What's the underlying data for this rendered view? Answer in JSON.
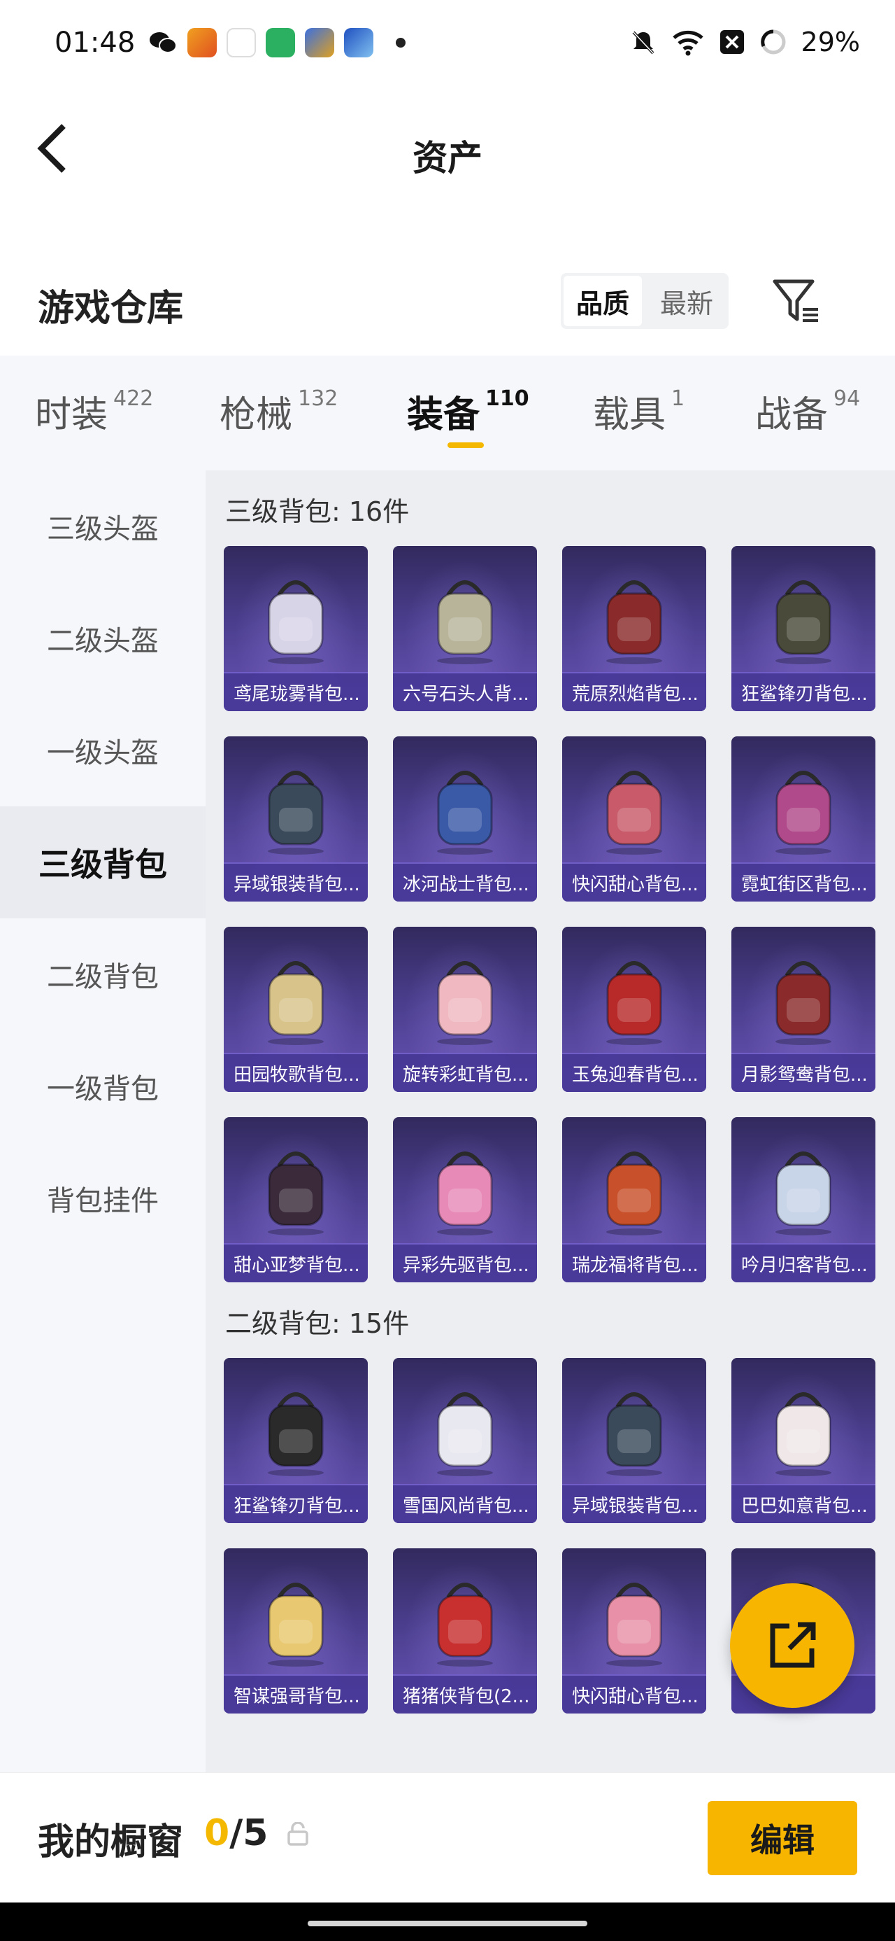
{
  "status_bar": {
    "time": "01:48",
    "battery": "29%"
  },
  "header": {
    "title": "资产"
  },
  "warehouse": {
    "title": "游戏仓库",
    "sort_options": [
      "品质",
      "最新"
    ],
    "active_sort": "品质"
  },
  "tabs": [
    {
      "label": "时装",
      "count": "422"
    },
    {
      "label": "枪械",
      "count": "132"
    },
    {
      "label": "装备",
      "count": "110"
    },
    {
      "label": "载具",
      "count": "1"
    },
    {
      "label": "战备",
      "count": "94"
    }
  ],
  "active_tab": "装备",
  "sidebar": {
    "items": [
      "三级头盔",
      "二级头盔",
      "一级头盔",
      "三级背包",
      "二级背包",
      "一级背包",
      "背包挂件"
    ],
    "active": "三级背包"
  },
  "sections": [
    {
      "title": "三级背包: 16件",
      "items": [
        {
          "name": "鸢尾珑雾背包...",
          "color": "#d8d4e8"
        },
        {
          "name": "六号石头人背...",
          "color": "#b8b49a"
        },
        {
          "name": "荒原烈焰背包...",
          "color": "#8a2a2a"
        },
        {
          "name": "狂鲨锋刃背包...",
          "color": "#4a4a3a"
        },
        {
          "name": "异域银装背包...",
          "color": "#3a4a5a"
        },
        {
          "name": "冰河战士背包...",
          "color": "#3a5aa8"
        },
        {
          "name": "快闪甜心背包...",
          "color": "#c85a6a"
        },
        {
          "name": "霓虹街区背包...",
          "color": "#b04a8a"
        },
        {
          "name": "田园牧歌背包...",
          "color": "#d8c48a"
        },
        {
          "name": "旋转彩虹背包...",
          "color": "#f0b8c0"
        },
        {
          "name": "玉兔迎春背包...",
          "color": "#b82a2a"
        },
        {
          "name": "月影鸳鸯背包...",
          "color": "#8a2a2a"
        },
        {
          "name": "甜心亚梦背包...",
          "color": "#3a2a3a"
        },
        {
          "name": "异彩先驱背包...",
          "color": "#e88ab8"
        },
        {
          "name": "瑞龙福将背包...",
          "color": "#c8502a"
        },
        {
          "name": "吟月归客背包...",
          "color": "#c8d4e8"
        }
      ]
    },
    {
      "title": "二级背包: 15件",
      "items": [
        {
          "name": "狂鲨锋刃背包...",
          "color": "#2a2a2a"
        },
        {
          "name": "雪国风尚背包...",
          "color": "#e8e8f0"
        },
        {
          "name": "异域银装背包...",
          "color": "#3a4a5a"
        },
        {
          "name": "巴巴如意背包...",
          "color": "#f0e8e8"
        },
        {
          "name": "智谋强哥背包...",
          "color": "#e8c870"
        },
        {
          "name": "猪猪侠背包(2...",
          "color": "#c83030"
        },
        {
          "name": "快闪甜心背包...",
          "color": "#e890a8"
        },
        {
          "name": "",
          "color": "#c8b060"
        }
      ]
    }
  ],
  "bottom_bar": {
    "label": "我的橱窗",
    "current": "0",
    "separator": "/",
    "total": "5",
    "edit_label": "编辑"
  },
  "colors": {
    "accent": "#f7b500",
    "card_bg": "#4a3d8c",
    "panel_bg": "#f5f7fb"
  }
}
